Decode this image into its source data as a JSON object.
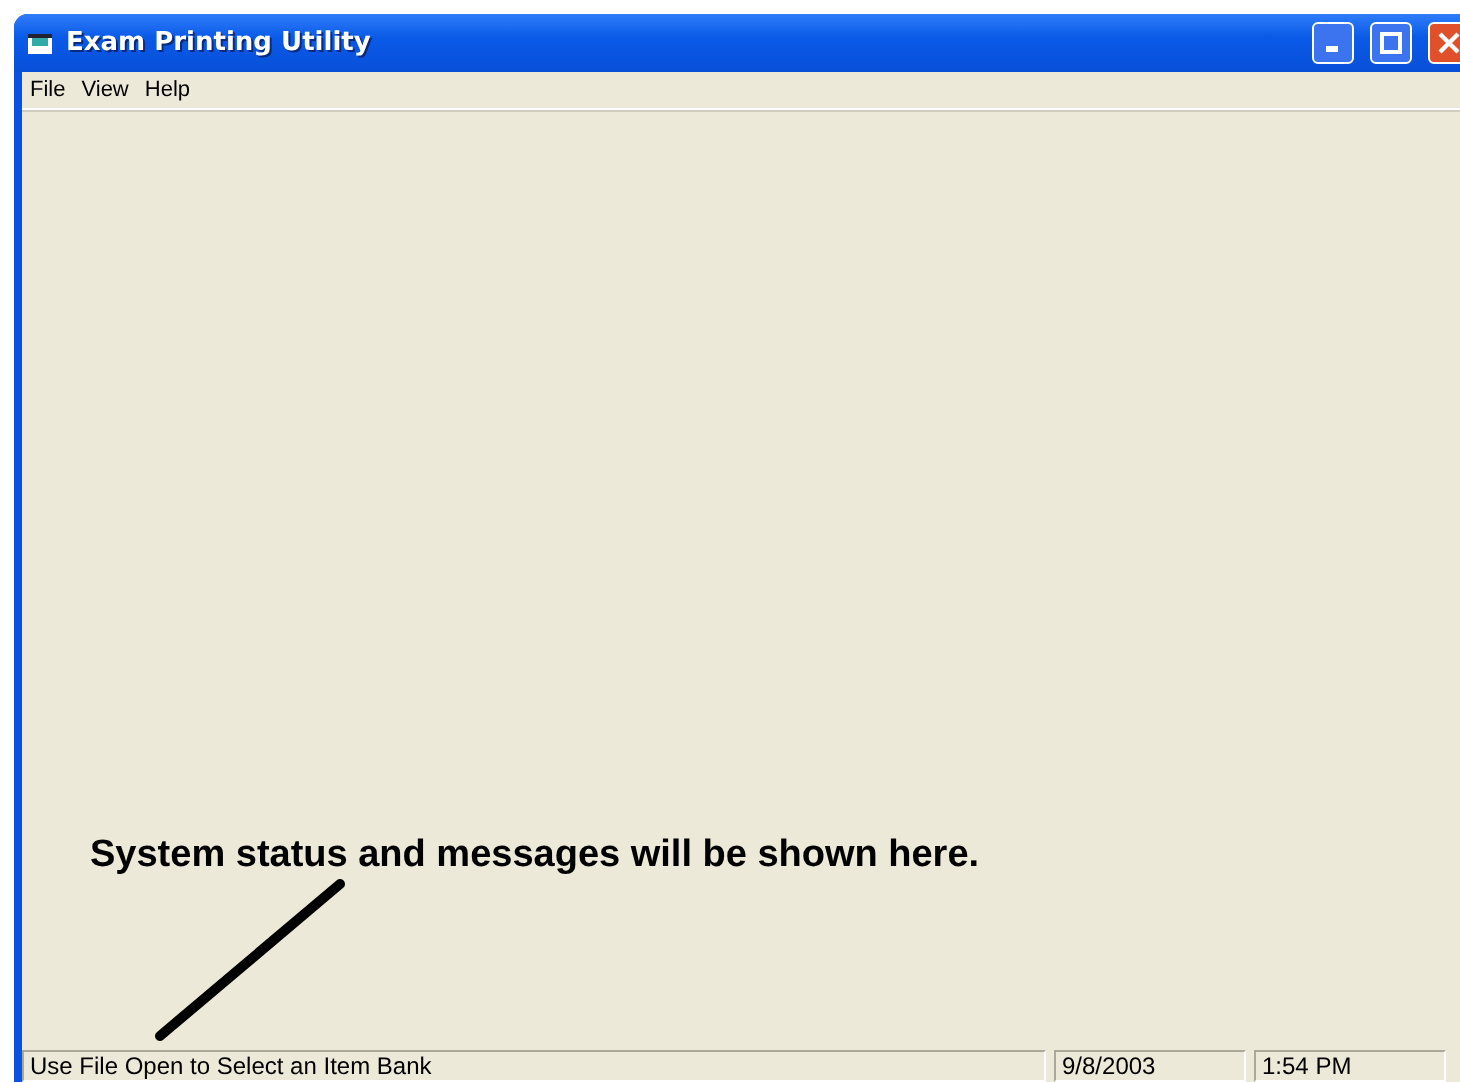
{
  "window": {
    "title": "Exam Printing Utility"
  },
  "menu": [
    "File",
    "View",
    "Help"
  ],
  "annotation": {
    "text": "System status and messages will be shown here."
  },
  "status_bar": [
    "Use File Open to Select an Item Bank",
    "9/8/2003",
    "1:54 PM"
  ]
}
